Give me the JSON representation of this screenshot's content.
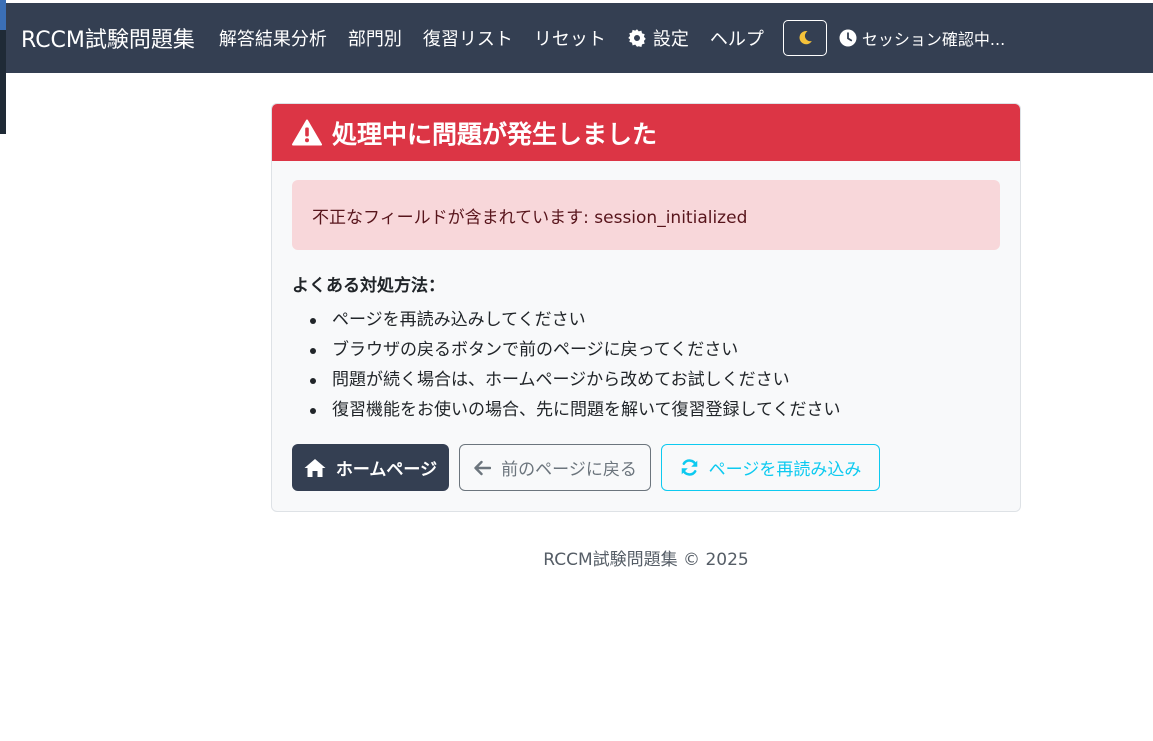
{
  "navbar": {
    "brand": "RCCM試験問題集",
    "links": [
      "解答結果分析",
      "部門別",
      "復習リスト",
      "リセット"
    ],
    "settings_label": "設定",
    "help_label": "ヘルプ",
    "session_status": "セッション確認中..."
  },
  "error_card": {
    "title": "処理中に問題が発生しました",
    "message": "不正なフィールドが含まれています: session_initialized",
    "tips_title": "よくある対処方法：",
    "tips": [
      "ページを再読み込みしてください",
      "ブラウザの戻るボタンで前のページに戻ってください",
      "問題が続く場合は、ホームページから改めてお試しください",
      "復習機能をお使いの場合、先に問題を解いて復習登録してください"
    ],
    "buttons": {
      "home": "ホームページ",
      "back": "前のページに戻る",
      "reload": "ページを再読み込み"
    }
  },
  "footer": {
    "text": "RCCM試験問題集 © 2025"
  },
  "colors": {
    "navbar": "#343f52",
    "danger": "#dc3545",
    "alert_bg": "#f8d7da",
    "secondary": "#6c757d",
    "info": "#0dcaf0"
  },
  "icons": {
    "settings": "gear-icon",
    "theme": "moon-icon",
    "session": "clock-icon",
    "header": "warning-triangle-icon",
    "home": "home-icon",
    "back": "arrow-left-icon",
    "reload": "sync-icon"
  }
}
